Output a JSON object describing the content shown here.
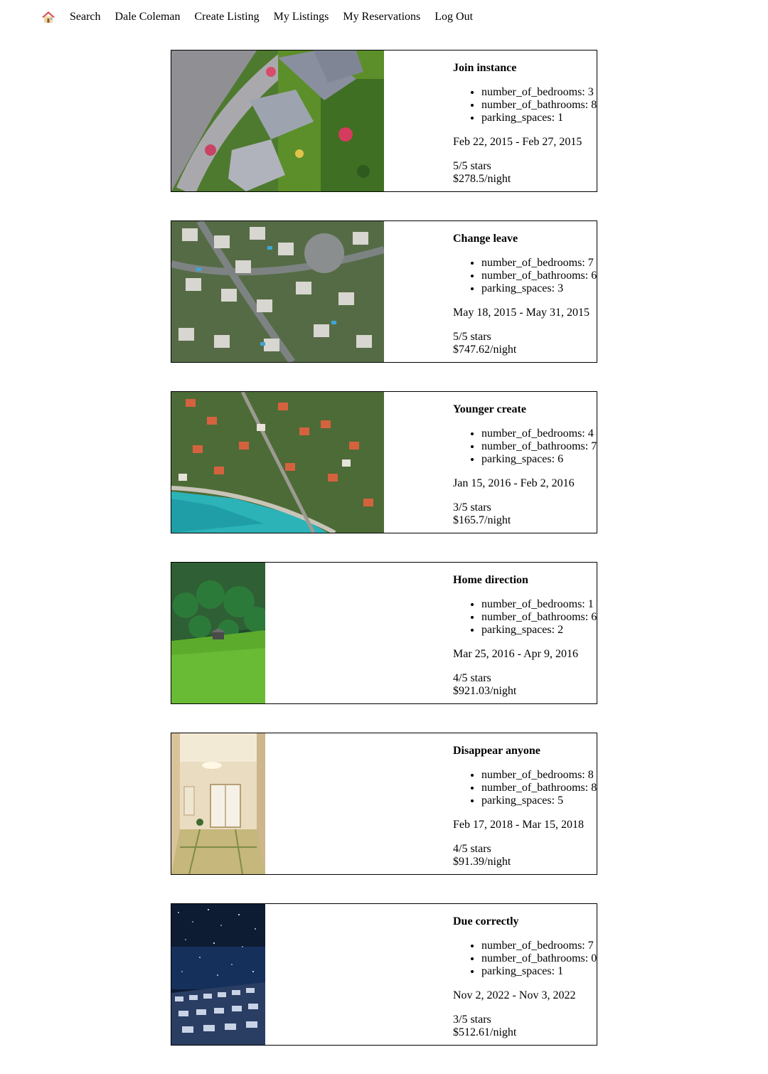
{
  "nav": {
    "home_icon": "home-icon",
    "links": [
      "Search",
      "Dale Coleman",
      "Create Listing",
      "My Listings",
      "My Reservations",
      "Log Out"
    ]
  },
  "reservations": [
    {
      "title": "Join instance",
      "features": [
        "number_of_bedrooms: 3",
        "number_of_bathrooms: 8",
        "parking_spaces: 1"
      ],
      "dates": "Feb 22, 2015 - Feb 27, 2015",
      "rating": "5/5 stars",
      "price": "$278.5/night",
      "image": "aerial-suburban-houses"
    },
    {
      "title": "Change leave",
      "features": [
        "number_of_bedrooms: 7",
        "number_of_bathrooms: 6",
        "parking_spaces: 3"
      ],
      "dates": "May 18, 2015 - May 31, 2015",
      "rating": "5/5 stars",
      "price": "$747.62/night",
      "image": "aerial-dense-neighborhood"
    },
    {
      "title": "Younger create",
      "features": [
        "number_of_bedrooms: 4",
        "number_of_bathrooms: 7",
        "parking_spaces: 6"
      ],
      "dates": "Jan 15, 2016 - Feb 2, 2016",
      "rating": "3/5 stars",
      "price": "$165.7/night",
      "image": "aerial-coastal-town"
    },
    {
      "title": "Home direction",
      "features": [
        "number_of_bedrooms: 1",
        "number_of_bathrooms: 6",
        "parking_spaces: 2"
      ],
      "dates": "Mar 25, 2016 - Apr 9, 2016",
      "rating": "4/5 stars",
      "price": "$921.03/night",
      "image": "forest-meadow-cabin"
    },
    {
      "title": "Disappear anyone",
      "features": [
        "number_of_bedrooms: 8",
        "number_of_bathrooms: 8",
        "parking_spaces: 5"
      ],
      "dates": "Feb 17, 2018 - Mar 15, 2018",
      "rating": "4/5 stars",
      "price": "$91.39/night",
      "image": "tatami-room"
    },
    {
      "title": "Due correctly",
      "features": [
        "number_of_bedrooms: 7",
        "number_of_bathrooms: 0",
        "parking_spaces: 1"
      ],
      "dates": "Nov 2, 2022 - Nov 3, 2022",
      "rating": "3/5 stars",
      "price": "$512.61/night",
      "image": "night-sky-village"
    }
  ]
}
